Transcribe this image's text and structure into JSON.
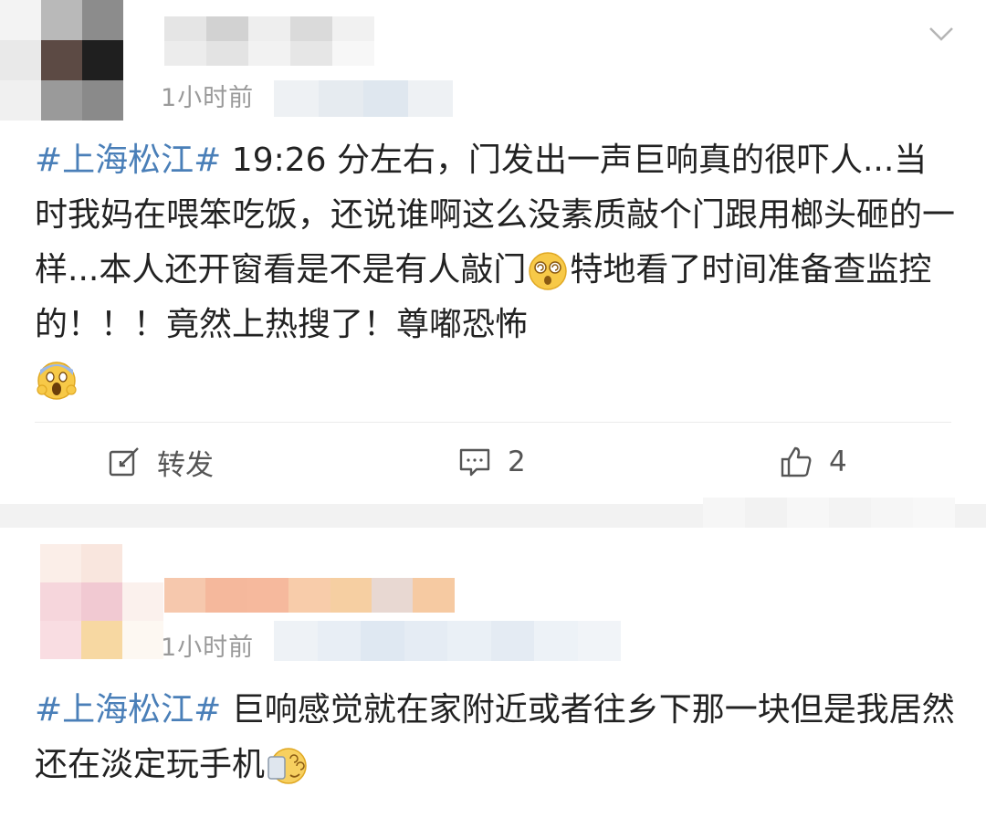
{
  "posts": [
    {
      "time": "1小时前",
      "topic": "#上海松江#",
      "text": " 19:26 分左右，门发出一声巨响真的很吓人...当时我妈在喂笨吃饭，还说谁啊这么没素质敲个门跟用榔头砸的一样...本人还开窗看是不是有人敲门",
      "emoji_1": "dizzy-face-emoji",
      "text_2": "特地看了时间准备查监控的！！！竟然上热搜了！尊嘟恐怖",
      "emoji_2": "screaming-face-emoji",
      "actions": {
        "repost_label": "转发",
        "comment_count": "2",
        "like_count": "4"
      }
    },
    {
      "time": "1小时前",
      "topic": "#上海松江#",
      "text": " 巨响感觉就在家附近或者往乡下那一块但是我居然还在淡定玩手机",
      "emoji_1": "dizzy-phone-emoji"
    }
  ],
  "colors": {
    "topic": "#4a7fb8",
    "text": "#222222",
    "time": "#9a9a9a",
    "separator": "#f2f2f2"
  },
  "icons": {
    "menu": "chevron-down-icon",
    "repost": "edit-icon",
    "comment": "comment-icon",
    "like": "thumbs-up-icon"
  }
}
